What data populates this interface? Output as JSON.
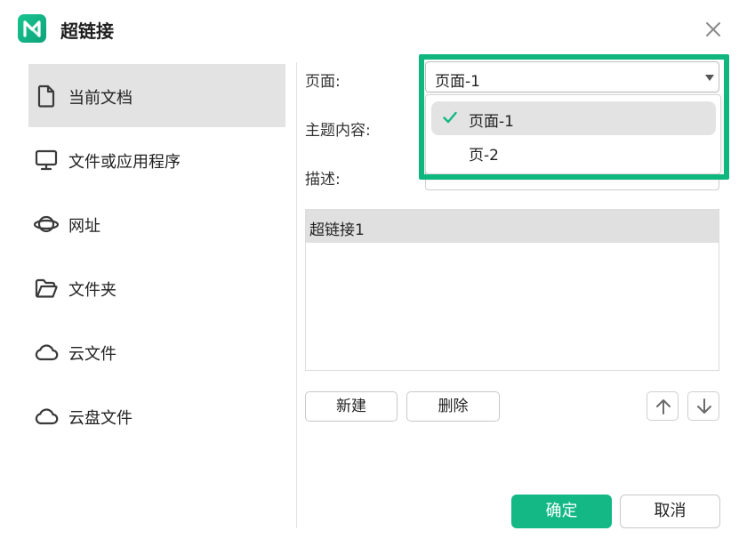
{
  "dialog": {
    "title": "超链接",
    "confirm_label": "确定",
    "cancel_label": "取消"
  },
  "colors": {
    "accent": "#13b884",
    "highlight": "#0fb77f",
    "active_bg": "#e3e3e3"
  },
  "sidebar": {
    "items": [
      {
        "label": "当前文档",
        "icon": "document-icon",
        "active": true
      },
      {
        "label": "文件或应用程序",
        "icon": "monitor-icon",
        "active": false
      },
      {
        "label": "网址",
        "icon": "planet-icon",
        "active": false
      },
      {
        "label": "文件夹",
        "icon": "folder-icon",
        "active": false
      },
      {
        "label": "云文件",
        "icon": "cloud-icon",
        "active": false
      },
      {
        "label": "云盘文件",
        "icon": "cloud-icon",
        "active": false
      }
    ]
  },
  "form": {
    "page_label": "页面:",
    "page_value": "页面-1",
    "page_options": [
      {
        "label": "页面-1",
        "selected": true
      },
      {
        "label": "页-2",
        "selected": false
      }
    ],
    "topic_label": "主题内容:",
    "description_label": "描述:"
  },
  "links": {
    "items": [
      "超链接1"
    ]
  },
  "actions": {
    "new_label": "新建",
    "delete_label": "删除"
  }
}
